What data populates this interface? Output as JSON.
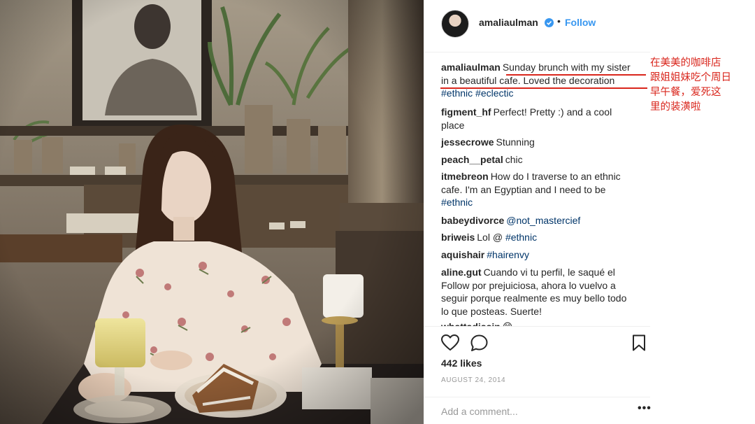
{
  "post": {
    "username": "amaliaulman",
    "follow_label": "Follow",
    "separator": "•"
  },
  "caption": {
    "username": "amaliaulman",
    "text_line1": "Sunday brunch with my sister",
    "text_line2": "in a beautiful cafe. Loved the decoration",
    "tag1": "#ethnic",
    "tag2": "#eclectic"
  },
  "comments": [
    {
      "user": "figment_hf",
      "line1": "Perfect! Pretty :) and a cool",
      "line2": "place"
    },
    {
      "user": "jessecrowe",
      "line1": "Stunning"
    },
    {
      "user": "peach__petal",
      "line1": "chic"
    },
    {
      "user": "itmebreon",
      "line1": "How do I traverse to an ethnic",
      "line2": "cafe. I'm an Egyptian and I need to be",
      "tag": "#ethnic"
    },
    {
      "user": "babeydivorce",
      "tag": "@not_mastercief"
    },
    {
      "user": "briweis",
      "line1": "Lol @",
      "tag": "#ethnic"
    },
    {
      "user": "aquishair",
      "tag": "#hairenvy"
    },
    {
      "user": "aline.gut",
      "line1": "Cuando vi tu perfil, le saqué el",
      "line2": "Follow por prejuiciosa, ahora lo vuelvo a",
      "line3": "seguir porque realmente es muy bello todo",
      "line4": "lo que posteas. Suerte!"
    },
    {
      "user": "whattadissin",
      "line1": "😁"
    }
  ],
  "likes_text": "442 likes",
  "date_text": "AUGUST 24, 2014",
  "add_comment_placeholder": "Add a comment...",
  "more_label": "•••",
  "annotation": {
    "line1": "在美美的咖啡店",
    "line2": "跟姐姐妹吃个周日",
    "line3": "早午餐，爱死这",
    "line4": "里的装潢啦"
  },
  "icons": {
    "heart": "heart-icon",
    "comment": "comment-icon",
    "bookmark": "bookmark-icon",
    "verified": "verified-badge-icon"
  },
  "colors": {
    "link_blue": "#3897f0",
    "hashtag_blue": "#003569",
    "annotation_red": "#d9261c",
    "muted_gray": "#999999"
  }
}
